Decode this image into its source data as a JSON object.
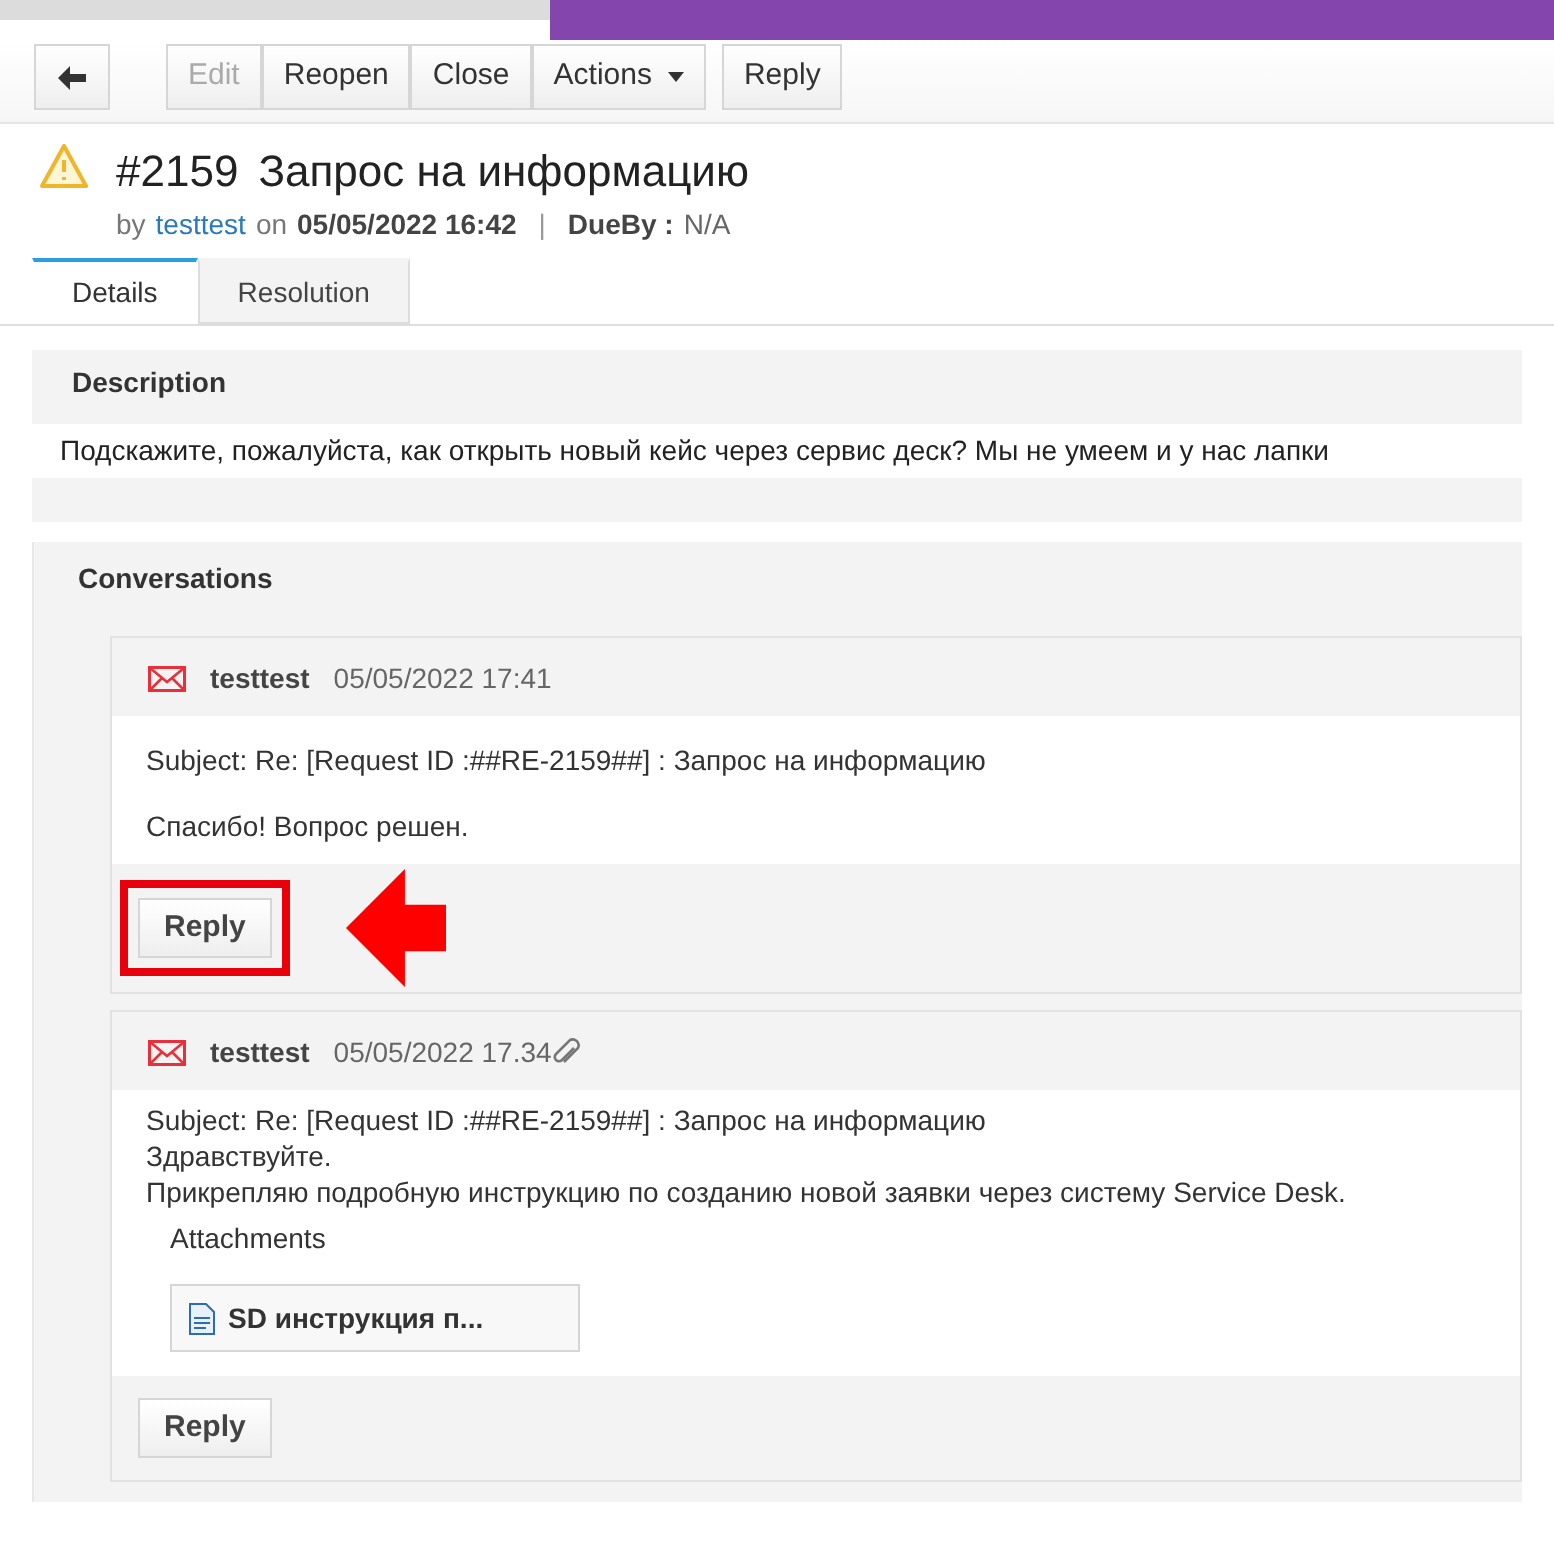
{
  "toolbar": {
    "buttons": [
      {
        "kind": "back"
      },
      {
        "kind": "text",
        "label": "Edit",
        "disabled": true
      },
      {
        "kind": "text",
        "label": "Reopen",
        "disabled": false
      },
      {
        "kind": "text",
        "label": "Close",
        "disabled": false
      },
      {
        "kind": "menu",
        "label": "Actions",
        "disabled": false
      },
      {
        "kind": "gap"
      },
      {
        "kind": "text",
        "label": "Reply",
        "disabled": false
      }
    ]
  },
  "request": {
    "number": "#2159",
    "title": "Запрос на информацию",
    "by_label": "by",
    "author": "testtest",
    "on_label": "on",
    "created": "05/05/2022 16:42",
    "separator": "|",
    "due_label": "DueBy :",
    "due": "N/A"
  },
  "tabs": [
    {
      "label": "Details",
      "selected": true
    },
    {
      "label": "Resolution",
      "selected": false
    }
  ],
  "description": {
    "heading": "Description",
    "text": "Подскажите, пожалуйста, как открыть новый кейс через сервис деск? Мы не умеем и у нас лапки"
  },
  "conversations": {
    "heading": "Conversations",
    "items": [
      {
        "author": "testtest",
        "time": "05/05/2022 17:41",
        "has_attachment": false,
        "subject": "Subject: Re: [Request ID :##RE-2159##] : Запрос на информацию",
        "body": [
          "Спасибо! Вопрос решен."
        ],
        "reply": "Reply",
        "highlighted": true
      },
      {
        "author": "testtest",
        "time": "05/05/2022 17.34",
        "has_attachment": true,
        "subject": "Subject: Re: [Request ID :##RE-2159##] : Запрос на информацию",
        "body": [
          "Здравствуйте.",
          "Прикрепляю подробную инструкцию по созданию новой заявки через систему Service Desk."
        ],
        "attachments_heading": "Attachments",
        "attachments": [
          "SD инструкция п..."
        ],
        "reply": "Reply",
        "highlighted": false
      }
    ]
  }
}
